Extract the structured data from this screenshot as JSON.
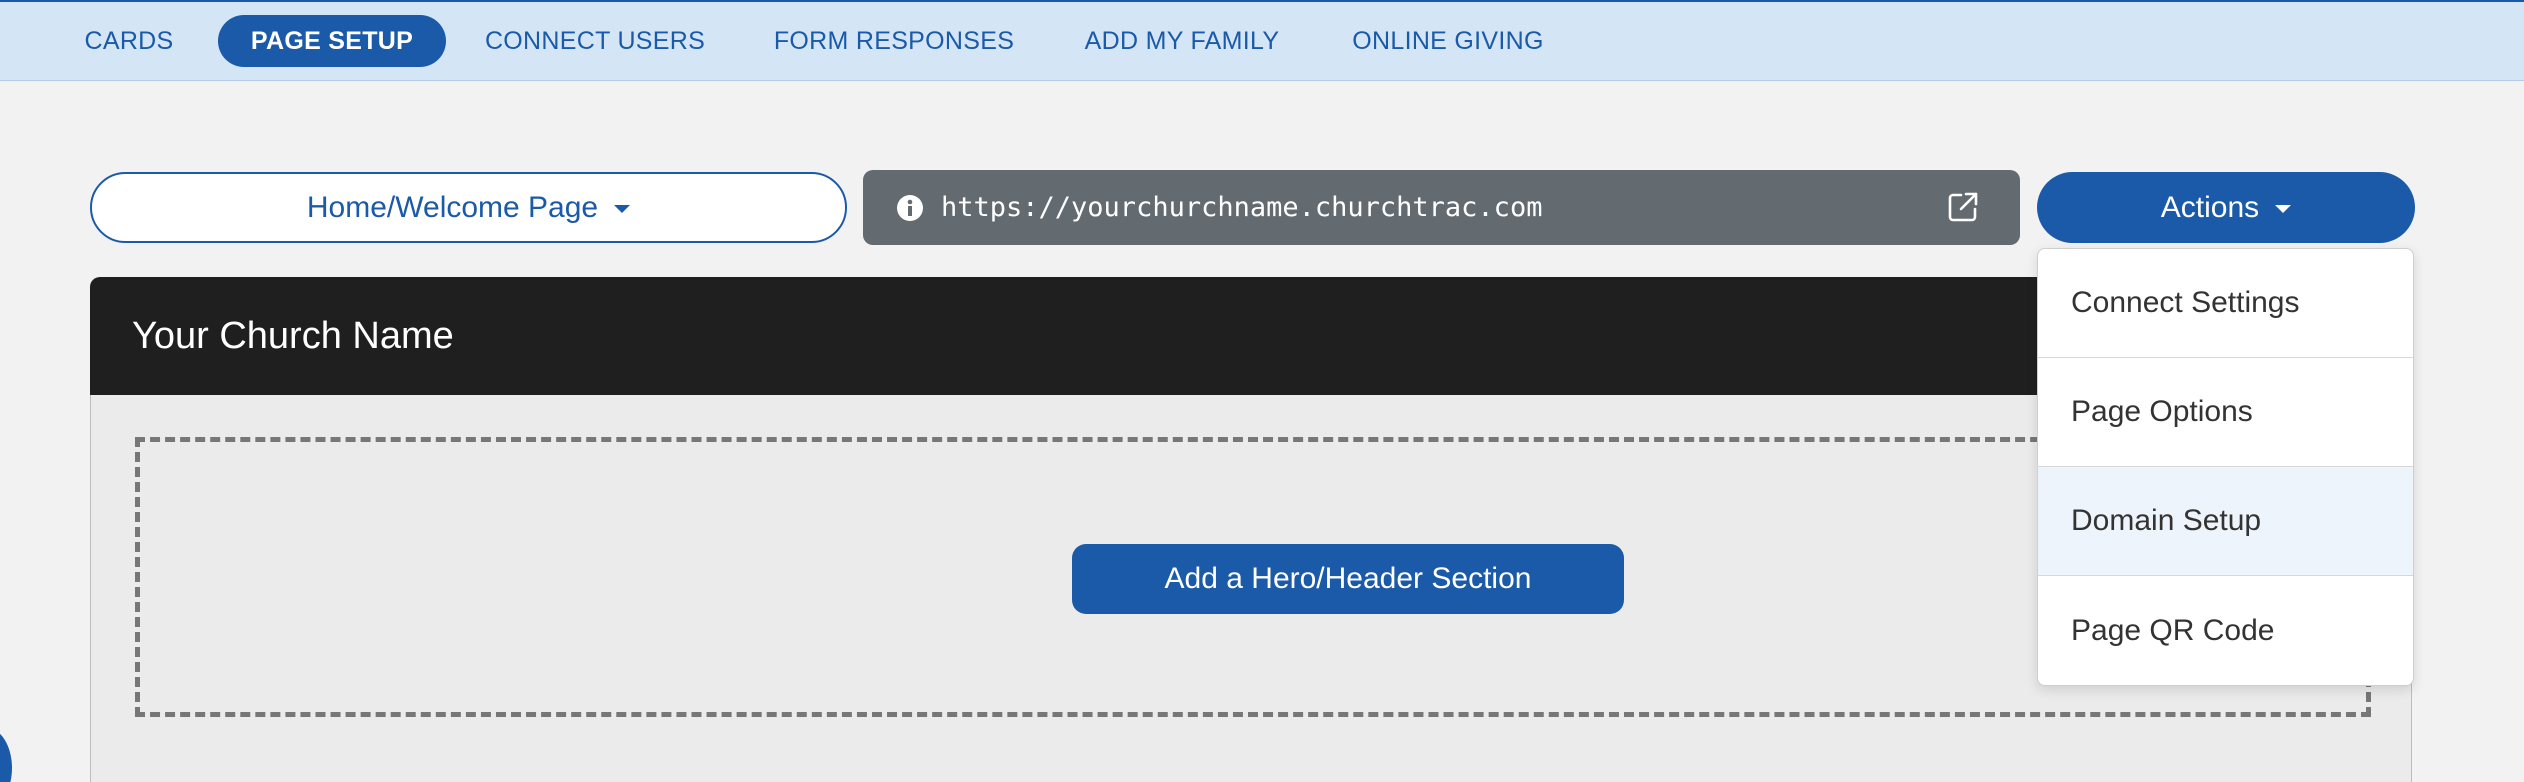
{
  "nav": {
    "items": [
      {
        "label": "CARDS"
      },
      {
        "label": "PAGE SETUP",
        "active": true
      },
      {
        "label": "CONNECT USERS"
      },
      {
        "label": "FORM RESPONSES"
      },
      {
        "label": "ADD MY FAMILY"
      },
      {
        "label": "ONLINE GIVING"
      }
    ]
  },
  "toolbar": {
    "page_select_value": "Home/Welcome Page",
    "url": "https://yourchurchname.churchtrac.com",
    "actions_label": "Actions",
    "info_icon": "info-circle-icon",
    "external_icon": "external-link-icon"
  },
  "actions_menu": {
    "items": [
      {
        "label": "Connect Settings"
      },
      {
        "label": "Page Options"
      },
      {
        "label": "Domain Setup",
        "highlighted": true
      },
      {
        "label": "Page QR Code"
      }
    ]
  },
  "preview": {
    "church_name": "Your Church Name",
    "hero_button_label": "Add a Hero/Header Section"
  },
  "colors": {
    "brand": "#1a5aa8",
    "nav_bg": "#d4e6f6",
    "url_bar_bg": "#636a70",
    "header_bg": "#1f1f1f",
    "page_bg": "#f2f2f2"
  }
}
